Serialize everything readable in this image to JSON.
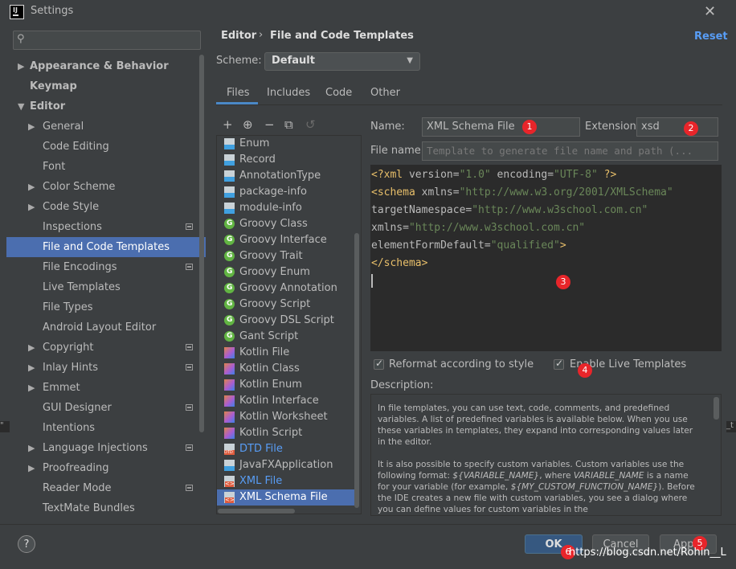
{
  "window": {
    "title": "Settings",
    "app_icon": "intellij-logo-icon",
    "close_icon": "close-icon"
  },
  "search": {
    "placeholder": "",
    "icon": "search-icon"
  },
  "sidebar": {
    "items": [
      {
        "label": "Appearance & Behavior",
        "arrow": "▶",
        "proj": false
      },
      {
        "label": "Keymap",
        "arrow": "",
        "proj": false
      },
      {
        "label": "Editor",
        "arrow": "▼",
        "proj": false
      },
      {
        "label": "General",
        "arrow": "▶",
        "proj": false
      },
      {
        "label": "Code Editing",
        "arrow": "",
        "proj": false
      },
      {
        "label": "Font",
        "arrow": "",
        "proj": false
      },
      {
        "label": "Color Scheme",
        "arrow": "▶",
        "proj": false
      },
      {
        "label": "Code Style",
        "arrow": "▶",
        "proj": false
      },
      {
        "label": "Inspections",
        "arrow": "",
        "proj": true
      },
      {
        "label": "File and Code Templates",
        "arrow": "",
        "proj": false
      },
      {
        "label": "File Encodings",
        "arrow": "",
        "proj": true
      },
      {
        "label": "Live Templates",
        "arrow": "",
        "proj": false
      },
      {
        "label": "File Types",
        "arrow": "",
        "proj": false
      },
      {
        "label": "Android Layout Editor",
        "arrow": "",
        "proj": false
      },
      {
        "label": "Copyright",
        "arrow": "▶",
        "proj": true
      },
      {
        "label": "Inlay Hints",
        "arrow": "▶",
        "proj": true
      },
      {
        "label": "Emmet",
        "arrow": "▶",
        "proj": false
      },
      {
        "label": "GUI Designer",
        "arrow": "",
        "proj": true
      },
      {
        "label": "Intentions",
        "arrow": "",
        "proj": false
      },
      {
        "label": "Language Injections",
        "arrow": "▶",
        "proj": true
      },
      {
        "label": "Proofreading",
        "arrow": "▶",
        "proj": false
      },
      {
        "label": "Reader Mode",
        "arrow": "",
        "proj": true
      },
      {
        "label": "TextMate Bundles",
        "arrow": "",
        "proj": false
      }
    ]
  },
  "breadcrumb": {
    "parent": "Editor",
    "separator": "›",
    "current": "File and Code Templates"
  },
  "reset_label": "Reset",
  "scheme": {
    "label": "Scheme:",
    "value": "Default",
    "chevron": "▼"
  },
  "tabs": [
    {
      "label": "Files"
    },
    {
      "label": "Includes"
    },
    {
      "label": "Code"
    },
    {
      "label": "Other"
    }
  ],
  "list_toolbar": {
    "add": "+",
    "copy_add": "⊕",
    "remove": "−",
    "duplicate": "⧉",
    "revert": "↺"
  },
  "templates": [
    {
      "label": "Enum",
      "icon": "java"
    },
    {
      "label": "Record",
      "icon": "java"
    },
    {
      "label": "AnnotationType",
      "icon": "java"
    },
    {
      "label": "package-info",
      "icon": "java"
    },
    {
      "label": "module-info",
      "icon": "java"
    },
    {
      "label": "Groovy Class",
      "icon": "groovy"
    },
    {
      "label": "Groovy Interface",
      "icon": "groovy"
    },
    {
      "label": "Groovy Trait",
      "icon": "groovy"
    },
    {
      "label": "Groovy Enum",
      "icon": "groovy"
    },
    {
      "label": "Groovy Annotation",
      "icon": "groovy"
    },
    {
      "label": "Groovy Script",
      "icon": "groovy"
    },
    {
      "label": "Groovy DSL Script",
      "icon": "groovy"
    },
    {
      "label": "Gant Script",
      "icon": "groovy"
    },
    {
      "label": "Kotlin File",
      "icon": "kotlin"
    },
    {
      "label": "Kotlin Class",
      "icon": "kotlin"
    },
    {
      "label": "Kotlin Enum",
      "icon": "kotlin"
    },
    {
      "label": "Kotlin Interface",
      "icon": "kotlin"
    },
    {
      "label": "Kotlin Worksheet",
      "icon": "kotlin"
    },
    {
      "label": "Kotlin Script",
      "icon": "kotlin"
    },
    {
      "label": "DTD File",
      "icon": "dtd"
    },
    {
      "label": "JavaFXApplication",
      "icon": "java"
    },
    {
      "label": "XML File",
      "icon": "xml"
    },
    {
      "label": "XML Schema File",
      "icon": "xml"
    }
  ],
  "form": {
    "name_label": "Name:",
    "name_value": "XML Schema File",
    "extension_label": "Extension:",
    "extension_value": "xsd",
    "file_name_label": "File name:",
    "file_name_placeholder": "Template to generate file name and path (..."
  },
  "code": {
    "l1_a": "<?xml ",
    "l1_b": "version",
    "l1_c": "=",
    "l1_d": "\"1.0\"",
    "l1_e": " encoding",
    "l1_f": "=",
    "l1_g": "\"UTF-8\"",
    "l1_h": " ?>",
    "l2_a": "<schema ",
    "l2_b": "xmlns",
    "l2_c": "=",
    "l2_d": "\"http://www.w3.org/2001/XMLSchema\"",
    "l3_a": "targetNamespace",
    "l3_b": "=",
    "l3_c": "\"http://www.w3school.com.cn\"",
    "l4_a": "xmlns",
    "l4_b": "=",
    "l4_c": "\"http://www.w3school.com.cn\"",
    "l5_a": "elementFormDefault",
    "l5_b": "=",
    "l5_c": "\"qualified\"",
    "l5_d": ">",
    "l6_a": "</schema>"
  },
  "options": {
    "reformat_label": "Reformat according to style",
    "reformat_checked": true,
    "live_templates_label": "Enable Live Templates",
    "live_templates_checked": true
  },
  "description": {
    "label": "Description:",
    "p1": "In file templates, you can use text, code, comments, and predefined variables. A list of predefined variables is available below. When you use these variables in templates, they expand into corresponding values later in the editor.",
    "p2a": "It is also possible to specify custom variables. Custom variables use the following format: ",
    "p2b": "${VARIABLE_NAME}",
    "p2c": ", where ",
    "p2d": "VARIABLE_NAME",
    "p2e": " is a name for your variable (for example, ",
    "p2f": "${MY_CUSTOM_FUNCTION_NAME}",
    "p2g": "). Before the IDE creates a new file with custom variables, you see a dialog where you can define values for custom variables in the"
  },
  "buttons": {
    "help": "?",
    "ok": "OK",
    "cancel": "Cancel",
    "apply": "Apply"
  },
  "badges": [
    "1",
    "2",
    "3",
    "4",
    "5",
    "6"
  ],
  "watermark": "https://blog.csdn.net/Rohin__L",
  "edge_left": "\"",
  "edge_right": "_t",
  "colors": {
    "selection": "#4b6eaf",
    "accent_link": "#589df6",
    "badge": "#e8252a",
    "ok_button": "#365880",
    "editor_bg": "#2b2b2b"
  }
}
